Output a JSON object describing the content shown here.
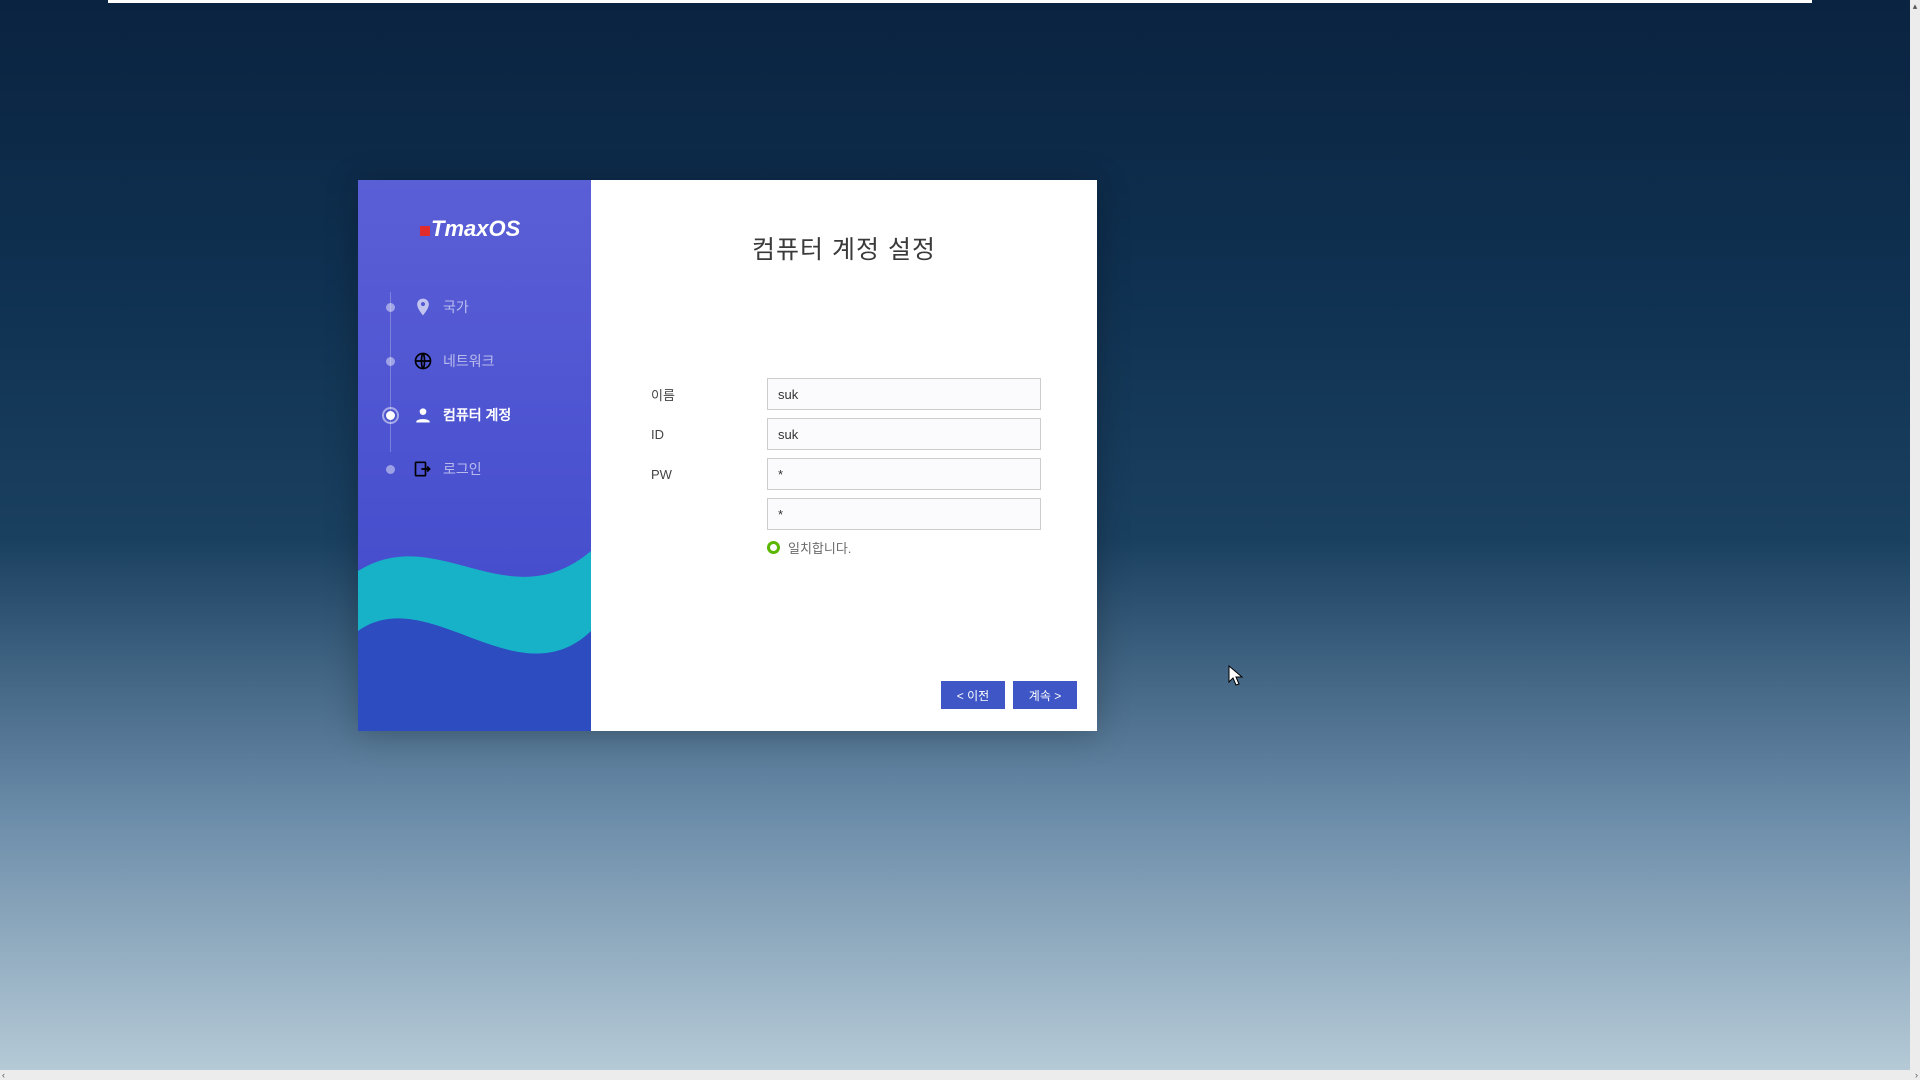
{
  "brand": "TmaxOS",
  "title": "컴퓨터 계정 설정",
  "sidebar": {
    "items": [
      {
        "label": "국가",
        "icon": "map-pin-icon",
        "active": false
      },
      {
        "label": "네트워크",
        "icon": "globe-icon",
        "active": false
      },
      {
        "label": "컴퓨터 계정",
        "icon": "person-icon",
        "active": true
      },
      {
        "label": "로그인",
        "icon": "login-icon",
        "active": false
      }
    ]
  },
  "form": {
    "name_label": "이름",
    "name_value": "suk",
    "id_label": "ID",
    "id_value": "suk",
    "pw_label": "PW",
    "pw_value": "*",
    "pw_confirm_value": "*",
    "status_text": "일치합니다."
  },
  "nav": {
    "prev_label": "< 이전",
    "next_label": "계속 >"
  },
  "scrollbar": {
    "left_arrow": "‹",
    "right_arrow": "›",
    "up_arrow": "▴"
  }
}
